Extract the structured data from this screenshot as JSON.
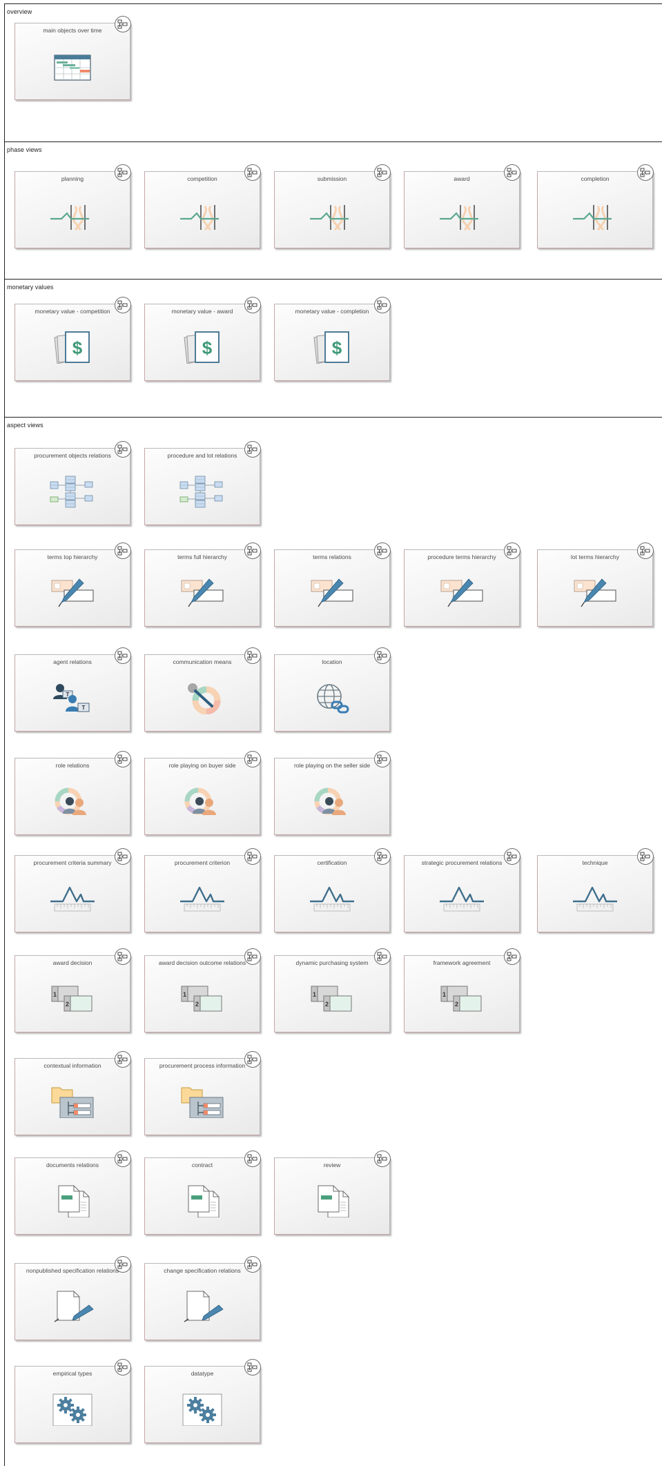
{
  "sections": [
    {
      "title": "overview",
      "cards": [
        {
          "label": "main objects over time",
          "icon": "gantt-chart-icon"
        }
      ]
    },
    {
      "title": "phase views",
      "cards": [
        {
          "label": "planning",
          "icon": "signal-wave-icon"
        },
        {
          "label": "competition",
          "icon": "signal-wave-icon"
        },
        {
          "label": "submission",
          "icon": "signal-wave-icon"
        },
        {
          "label": "award",
          "icon": "signal-wave-icon"
        },
        {
          "label": "completion",
          "icon": "signal-wave-icon"
        }
      ]
    },
    {
      "title": "monetary values",
      "cards": [
        {
          "label": "monetary value - competition",
          "icon": "dollar-document-icon",
          "symbol": "$"
        },
        {
          "label": "monetary value - award",
          "icon": "dollar-document-icon",
          "symbol": "$"
        },
        {
          "label": "monetary value - completion",
          "icon": "dollar-document-icon",
          "symbol": "$"
        }
      ]
    },
    {
      "title": "aspect views",
      "cards": [
        {
          "label": "procurement objects relations",
          "icon": "class-diagram-icon"
        },
        {
          "label": "procedure and lot relations",
          "icon": "class-diagram-icon"
        },
        {
          "label": "terms top hierarchy",
          "icon": "edit-form-icon"
        },
        {
          "label": "terms full hierarchy",
          "icon": "edit-form-icon"
        },
        {
          "label": "terms relations",
          "icon": "edit-form-icon"
        },
        {
          "label": "procedure terms hierarchy",
          "icon": "edit-form-icon"
        },
        {
          "label": "lot terms hierarchy",
          "icon": "edit-form-icon"
        },
        {
          "label": "agent relations",
          "icon": "agents-icon",
          "tag": "T"
        },
        {
          "label": "communication means",
          "icon": "microphone-icon"
        },
        {
          "label": "location",
          "icon": "globe-link-icon"
        },
        {
          "label": "role relations",
          "icon": "users-roles-icon"
        },
        {
          "label": "role playing on buyer side",
          "icon": "users-roles-icon"
        },
        {
          "label": "role playing on the seller side",
          "icon": "users-roles-icon"
        },
        {
          "label": "procurement criteria summary",
          "icon": "measure-wave-icon"
        },
        {
          "label": "procurement criterion",
          "icon": "measure-wave-icon"
        },
        {
          "label": "certification",
          "icon": "measure-wave-icon"
        },
        {
          "label": "strategic procurement relations",
          "icon": "measure-wave-icon"
        },
        {
          "label": "technique",
          "icon": "measure-wave-icon"
        },
        {
          "label": "award decision",
          "icon": "numbered-cards-icon",
          "num1": "1",
          "num2": "2"
        },
        {
          "label": "award decision outcome relations",
          "icon": "numbered-cards-icon",
          "num1": "1",
          "num2": "2"
        },
        {
          "label": "dynamic purchasing system",
          "icon": "numbered-cards-icon",
          "num1": "1",
          "num2": "2"
        },
        {
          "label": "framework agreement",
          "icon": "numbered-cards-icon",
          "num1": "1",
          "num2": "2"
        },
        {
          "label": "contextual information",
          "icon": "folder-tree-icon"
        },
        {
          "label": "procurement process information",
          "icon": "folder-tree-icon"
        },
        {
          "label": "documents relations",
          "icon": "documents-icon"
        },
        {
          "label": "contract",
          "icon": "documents-icon"
        },
        {
          "label": "review",
          "icon": "documents-icon"
        },
        {
          "label": "nonpublished specification relations",
          "icon": "code-document-icon",
          "code": "</>"
        },
        {
          "label": "change specification relations",
          "icon": "code-document-icon",
          "code": "</>"
        },
        {
          "label": "empirical types",
          "icon": "gears-icon"
        },
        {
          "label": "datatype",
          "icon": "gears-icon"
        }
      ]
    }
  ]
}
